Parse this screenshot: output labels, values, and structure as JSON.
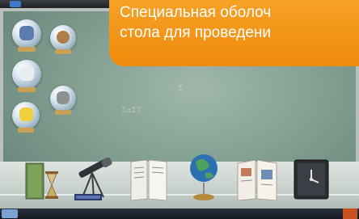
{
  "window": {
    "title": ""
  },
  "banner": {
    "line1": "Специальная оболоч",
    "line2": "стола для проведени"
  },
  "chalkboard": {
    "scribbles": [
      "ΣαΣϒ",
      "Σ"
    ]
  },
  "desktop_icons": [
    {
      "name": "books-icon"
    },
    {
      "name": "world-icon"
    },
    {
      "name": "house-icon"
    },
    {
      "name": "stand-icon"
    },
    {
      "name": "paint-icon"
    }
  ],
  "shelf_tools": [
    {
      "name": "hourglass-book-icon"
    },
    {
      "name": "telescope-icon"
    },
    {
      "name": "document-icon"
    },
    {
      "name": "globe-icon"
    },
    {
      "name": "open-book-icon"
    },
    {
      "name": "clock-icon"
    }
  ],
  "colors": {
    "banner": "#f39914",
    "board": "#86a295",
    "taskbar": "#1b222c",
    "tray": "#c9501f"
  }
}
